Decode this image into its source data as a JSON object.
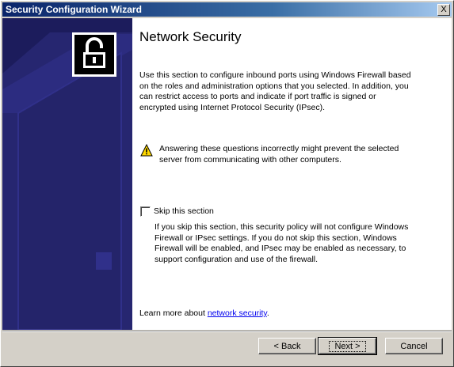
{
  "window": {
    "title": "Security Configuration Wizard",
    "close_glyph": "X"
  },
  "page": {
    "title": "Network Security",
    "intro_lines": [
      "Use this section to configure inbound ports using Windows Firewall based",
      "on the roles and administration options that you selected. In addition, you",
      "can restrict access to ports and indicate if port traffic is signed or",
      "encrypted using Internet Protocol Security (IPsec)."
    ],
    "warning_lines": [
      "Answering these questions incorrectly might prevent the selected",
      "server from communicating with other computers."
    ],
    "skip_checkbox": {
      "label": "Skip this section",
      "checked": false
    },
    "skip_description_lines": [
      "If you skip this section, this security policy will not configure Windows",
      "Firewall or IPsec settings. If you do not skip this section, Windows",
      "Firewall will be enabled, and IPsec may be enabled as necessary, to",
      "support configuration and use of the firewall."
    ],
    "learn_more_prefix": "Learn more about ",
    "learn_more_link": "network security",
    "learn_more_suffix": "."
  },
  "buttons": {
    "back": "< Back",
    "next": "Next >",
    "cancel": "Cancel"
  },
  "icons": {
    "sidebar": "server-graphic",
    "header": "padlock-icon",
    "warning": "warning-icon"
  },
  "colors": {
    "title_bar": "#0a246a",
    "sidebar": "#1c1c5c",
    "link": "#0000ee"
  }
}
